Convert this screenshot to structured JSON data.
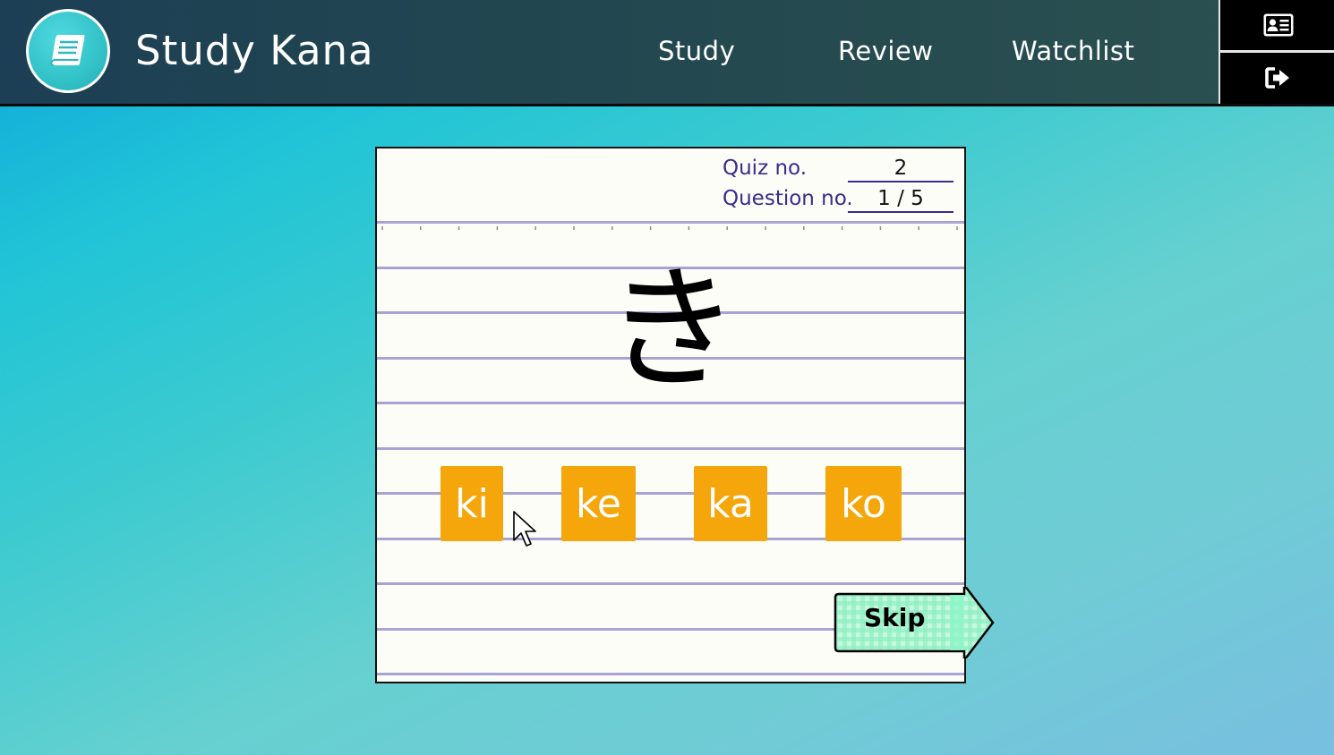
{
  "header": {
    "title": "Study Kana",
    "logo_icon": "book-icon",
    "nav": [
      {
        "label": "Study"
      },
      {
        "label": "Review"
      },
      {
        "label": "Watchlist"
      }
    ],
    "side_buttons": [
      {
        "icon": "profile-card-icon"
      },
      {
        "icon": "logout-icon"
      }
    ]
  },
  "quiz": {
    "quiz_label": "Quiz no.",
    "quiz_value": "2",
    "question_label": "Question no.",
    "question_value": "1 / 5",
    "kana": "き",
    "options": [
      {
        "label": "ki"
      },
      {
        "label": "ke"
      },
      {
        "label": "ka"
      },
      {
        "label": "ko"
      }
    ],
    "skip_label": "Skip"
  },
  "colors": {
    "accent_orange": "#f4a60b",
    "meta_text": "#3a2c8a",
    "rule_line": "#a8a3d2",
    "skip_green": "#8ff5c8"
  }
}
